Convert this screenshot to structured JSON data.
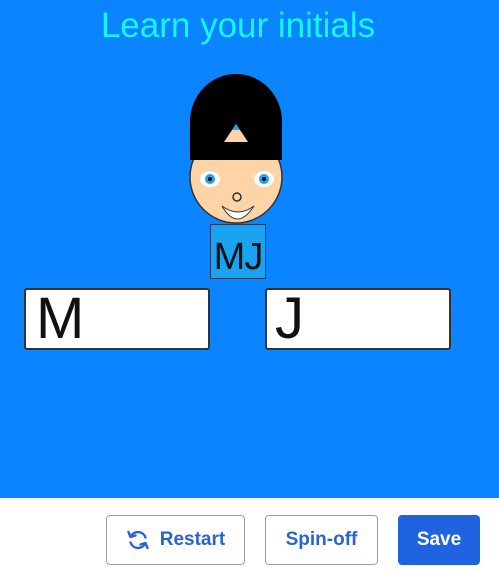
{
  "app": {
    "title": "Learn your initials",
    "initials_badge": "MJ",
    "initial_first": "M",
    "initial_second": "J"
  },
  "toolbar": {
    "restart_label": "Restart",
    "spinoff_label": "Spin-off",
    "save_label": "Save"
  },
  "icons": {
    "restart": "restart-icon"
  },
  "colors": {
    "stage_background": "#0a84ff",
    "title_text": "#17f5f5",
    "primary_button": "#1f63e0",
    "secondary_button_text": "#2a63d6"
  }
}
